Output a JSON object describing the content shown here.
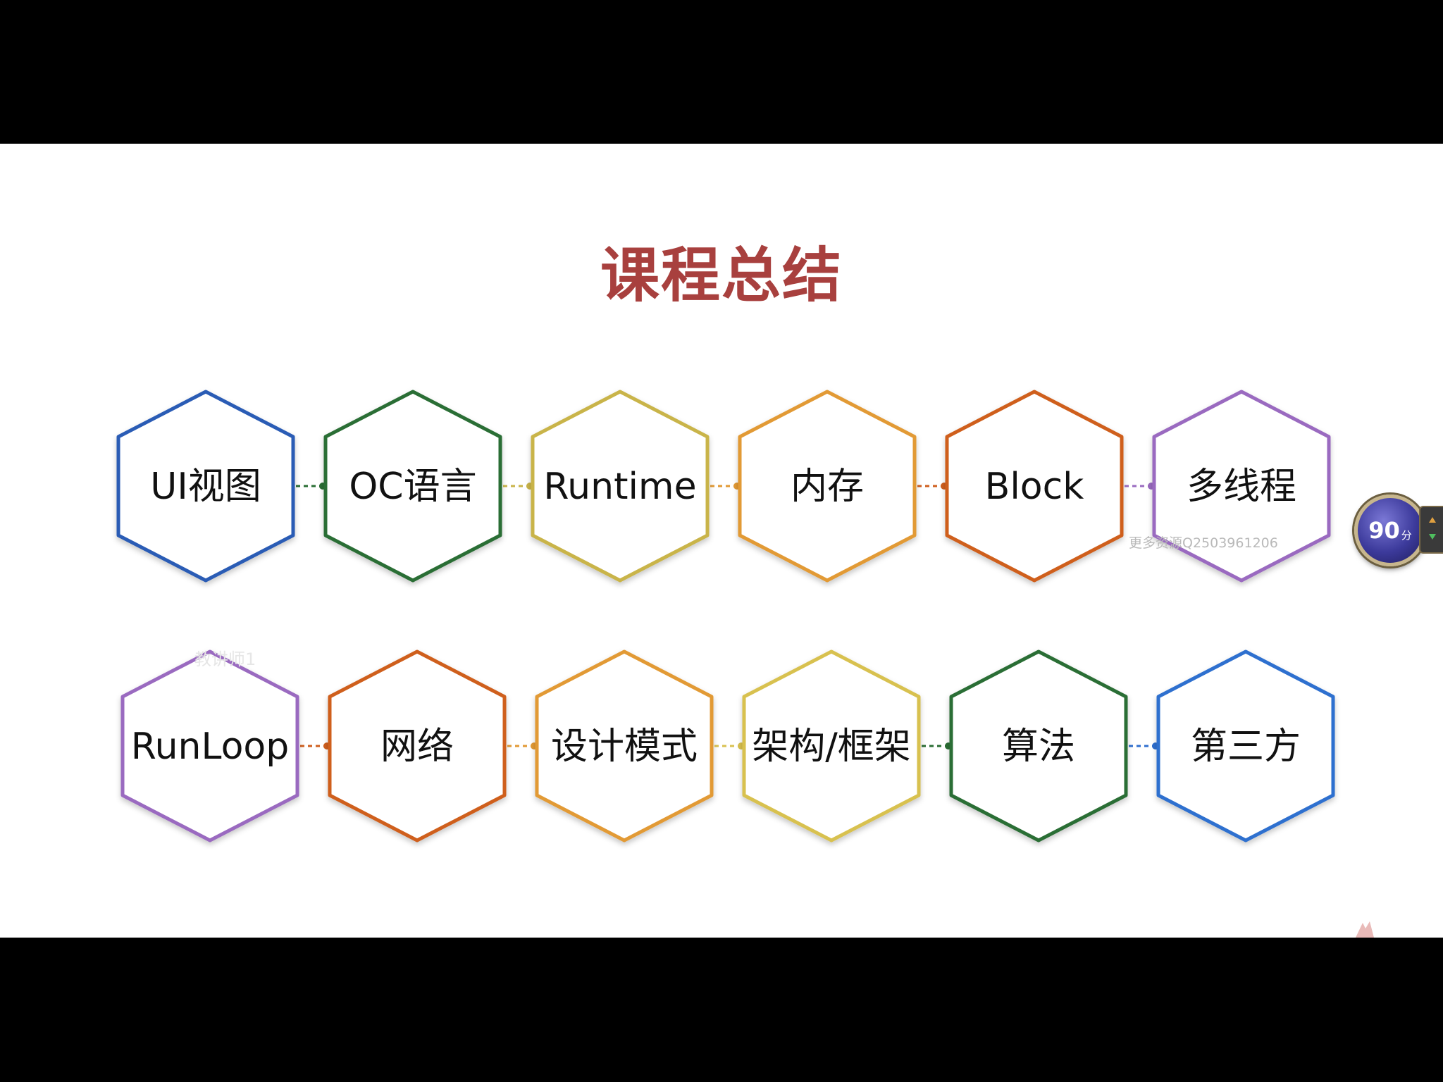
{
  "slide": {
    "title": "课程总结"
  },
  "diagram": {
    "rows": [
      [
        {
          "label": "UI视图",
          "color": "#2b5bb5"
        },
        {
          "label": "OC语言",
          "color": "#2a6e34"
        },
        {
          "label": "Runtime",
          "color": "#c9b44a"
        },
        {
          "label": "内存",
          "color": "#e29a35"
        },
        {
          "label": "Block",
          "color": "#cf5f1e"
        },
        {
          "label": "多线程",
          "color": "#9a6bc0"
        }
      ],
      [
        {
          "label": "RunLoop",
          "color": "#9a6bc0"
        },
        {
          "label": "网络",
          "color": "#cf5f1e"
        },
        {
          "label": "设计模式",
          "color": "#e29a35"
        },
        {
          "label": "架构/框架",
          "color": "#d8c150"
        },
        {
          "label": "算法",
          "color": "#2a6e34"
        },
        {
          "label": "第三方",
          "color": "#2f6fcf"
        }
      ]
    ]
  },
  "overlay": {
    "watermark": "更多资源Q2503961206",
    "faint_label": "教讲师1",
    "score_value": "90",
    "score_unit": "分"
  }
}
